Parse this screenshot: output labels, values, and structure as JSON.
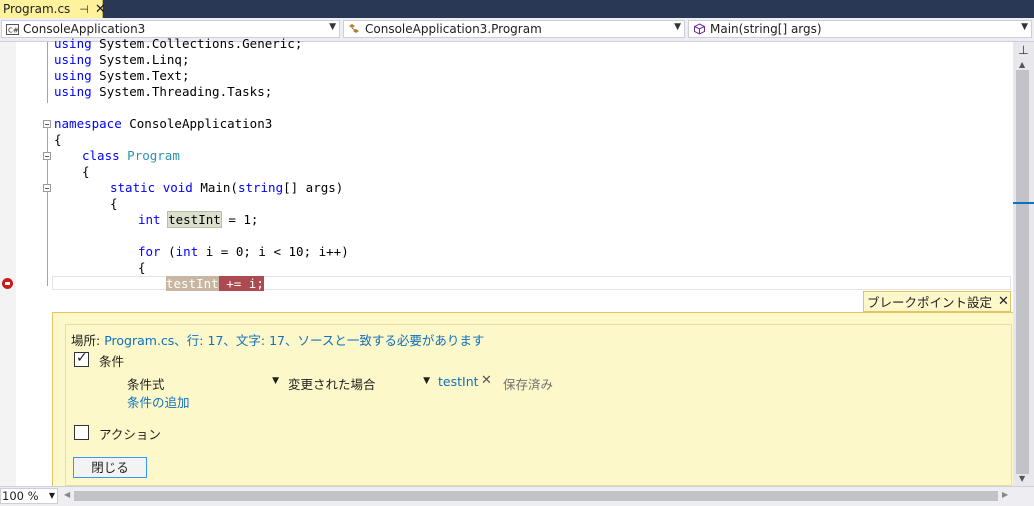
{
  "tab": {
    "title": "Program.cs",
    "pin": "⊣",
    "close": "✕"
  },
  "nav": {
    "project": "ConsoleApplication3",
    "type": "ConsoleApplication3.Program",
    "member": "Main(string[] args)",
    "icon_project": "csharp-project-icon",
    "icon_type": "class-icon",
    "icon_member": "method-icon"
  },
  "code": {
    "lines": [
      [
        "using",
        " System.Collections.Generic;"
      ],
      [
        "using",
        " System.Linq;"
      ],
      [
        "using",
        " System.Text;"
      ],
      [
        "using",
        " System.Threading.Tasks;"
      ]
    ],
    "ns_kw": "namespace",
    "ns_name": " ConsoleApplication3",
    "brace_open": "{",
    "class_kw": "class",
    "class_name": "Program",
    "static_kw": "static",
    "void_kw": "void",
    "main_sig_a": " Main(",
    "string_kw": "string",
    "main_sig_b": "[] args)",
    "int_kw": "int",
    "testint": "testInt",
    "assign": " = 1;",
    "for_kw": "for",
    "for_a": " (",
    "for_int": "int",
    "for_b": " i = 0; i < 10; i++)",
    "bp_var": "testInt",
    "bp_rest": " += i;"
  },
  "breakpoint": {
    "header_title": "ブレークポイント設定",
    "header_close": "✕",
    "location_label": "場所:",
    "location_value": "Program.cs、行: 17、文字: 17、ソースと一致する必要があります",
    "condition_label": "条件",
    "condition_checked": "✓",
    "cond_type": "条件式",
    "cond_op": "変更された場合",
    "cond_expr": "testInt",
    "cond_remove": "✕",
    "cond_saved": "保存済み",
    "add_condition": "条件の追加",
    "action_label": "アクション",
    "close_button": "閉じる"
  },
  "status": {
    "zoom": "100 %"
  },
  "colors": {
    "accent_tab": "#fff29d",
    "breakpoint": "#c71d1d",
    "panel": "#fdf8c9"
  }
}
